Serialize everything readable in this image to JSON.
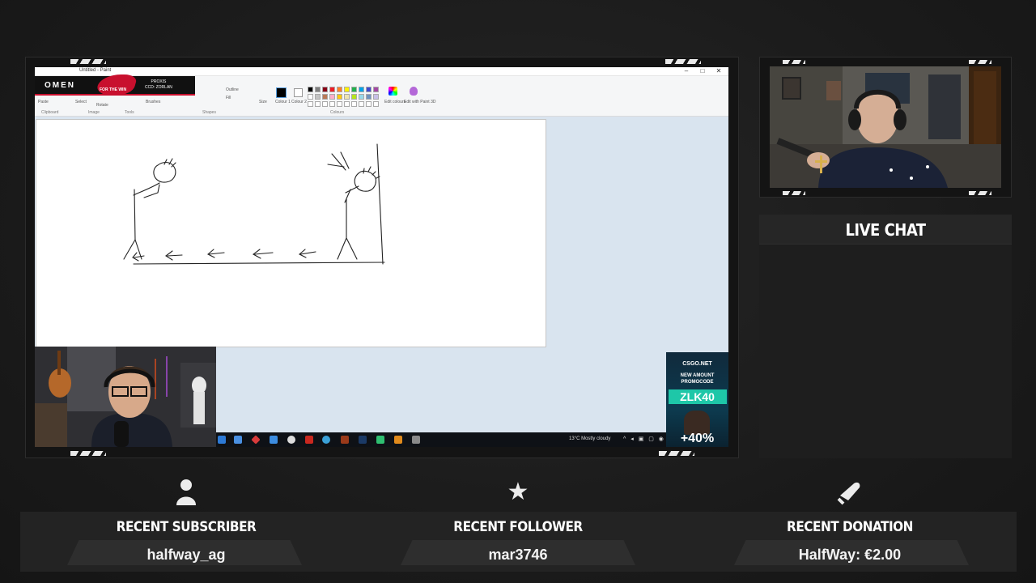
{
  "paint": {
    "title": "Untitled - Paint",
    "ribbon_groups": [
      "Clipboard",
      "Image",
      "Tools",
      "Shapes",
      "Colours"
    ],
    "ribbon_items": [
      "Paste",
      "Select",
      "Rotate",
      "Brushes",
      "Size",
      "Colour 1",
      "Colour 2",
      "Edit colours",
      "Edit with Paint 3D"
    ],
    "shape_options": [
      "Outline",
      "Fill"
    ]
  },
  "sponsor": {
    "brand": "OMEN",
    "tagline": "FOR THE WIN",
    "promo_line1": "PROXIS",
    "promo_line2": "CCD: ZORLAN"
  },
  "taskbar": {
    "weather": "13°C  Mostly cloudy"
  },
  "promo": {
    "site": "CSGO.NET",
    "text": "NEW AMOUNT PROMOCODE",
    "code": "ZLK40",
    "percent": "+40%"
  },
  "chat": {
    "header": "LIVE CHAT"
  },
  "alerts": [
    {
      "title": "RECENT SUBSCRIBER",
      "value": "halfway_ag",
      "icon": "user-icon"
    },
    {
      "title": "RECENT FOLLOWER",
      "value": "mar3746",
      "icon": "star-icon"
    },
    {
      "title": "RECENT DONATION",
      "value": "HalfWay: €2.00",
      "icon": "donation-icon"
    }
  ],
  "colors": {
    "background": "#1c1c1c",
    "panel": "#232323",
    "promo_accent": "#1ec7a8",
    "sponsor_red": "#c8102e"
  }
}
